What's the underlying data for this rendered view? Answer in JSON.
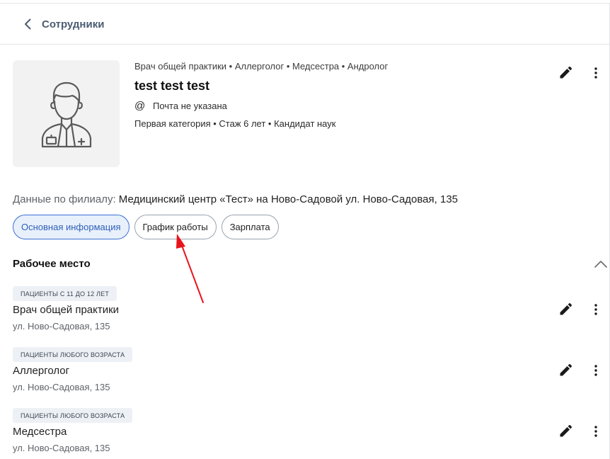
{
  "header": {
    "back_label": "Сотрудники"
  },
  "employee": {
    "specialties": "Врач общей практики • Аллерголог • Медсестра • Андролог",
    "name": "test test test",
    "email_icon": "@",
    "email_text": "Почта не указана",
    "details": "Первая категория • Стаж 6 лет • Кандидат наук"
  },
  "branch": {
    "label": "Данные по филиалу:",
    "value": "Медицинский центр «Тест» на Ново-Садовой ул. Ново-Садовая, 135"
  },
  "tabs": [
    {
      "label": "Основная информация",
      "active": true
    },
    {
      "label": "График работы",
      "active": false
    },
    {
      "label": "Зарплата",
      "active": false
    }
  ],
  "section": {
    "title": "Рабочее место"
  },
  "workplaces": [
    {
      "badge": "ПАЦИЕНТЫ С 11 ДО 12 ЛЕТ",
      "title": "Врач общей практики",
      "address": "ул. Ново-Садовая, 135"
    },
    {
      "badge": "ПАЦИЕНТЫ ЛЮБОГО ВОЗРАСТА",
      "title": "Аллерголог",
      "address": "ул. Ново-Садовая, 135"
    },
    {
      "badge": "ПАЦИЕНТЫ ЛЮБОГО ВОЗРАСТА",
      "title": "Медсестра",
      "address": "ул. Ново-Садовая, 135"
    }
  ],
  "colors": {
    "accent": "#3b6fd4",
    "annotation_arrow": "#e8141b"
  },
  "icons": [
    "chevron-left-icon",
    "doctor-avatar-icon",
    "at-icon",
    "pencil-icon",
    "more-vertical-icon",
    "chevron-up-icon"
  ]
}
